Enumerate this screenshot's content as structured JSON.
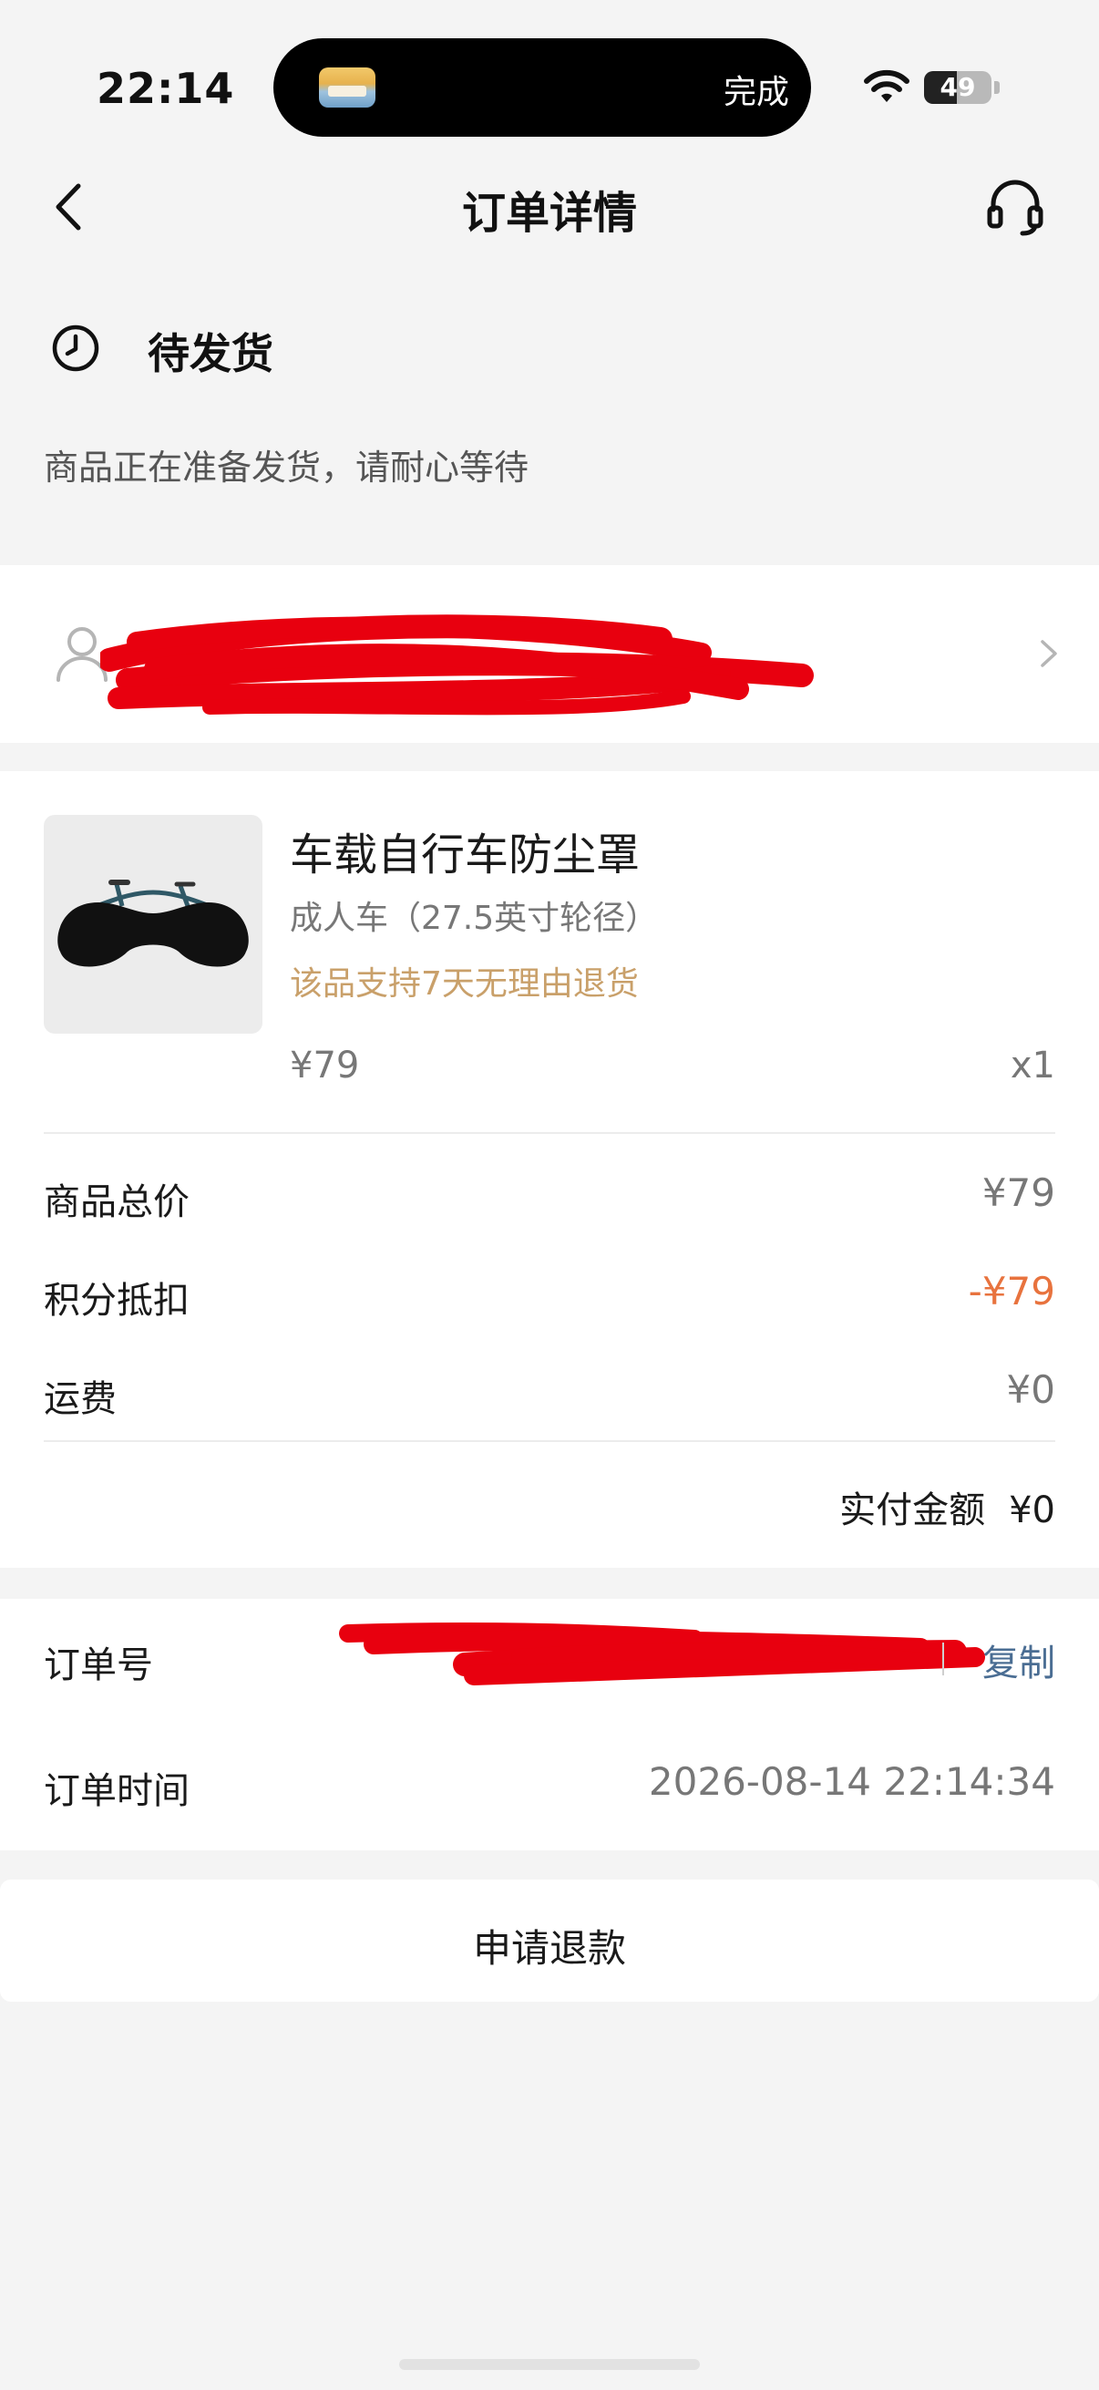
{
  "status_bar": {
    "time": "22:14",
    "island_text": "完成",
    "battery": "49",
    "battery_level": 0.49
  },
  "nav": {
    "title": "订单详情",
    "back_icon": "chevron-left-icon",
    "service_icon": "headset-icon"
  },
  "order_status": {
    "title": "待发货",
    "description": "商品正在准备发货，请耐心等待"
  },
  "address": {
    "name": "",
    "detail": ""
  },
  "product": {
    "name": "车载自行车防尘罩",
    "spec": "成人车（27.5英寸轮径）",
    "return_policy": "该品支持7天无理由退货",
    "price": "¥79",
    "quantity": "x1"
  },
  "summary": {
    "rows": [
      {
        "label": "商品总价",
        "value": "¥79"
      },
      {
        "label": "积分抵扣",
        "value": "-¥79"
      },
      {
        "label": "运费",
        "value": "¥0"
      }
    ],
    "paid_label": "实付金额",
    "paid_value": "¥0"
  },
  "order_info": {
    "number_label": "订单号",
    "copy_label": "复制",
    "time_label": "订单时间",
    "time_value": "2026-08-14 22:14:34"
  },
  "actions": {
    "refund_label": "申请退款"
  },
  "colors": {
    "accent_orange": "#e8733e",
    "return_gold": "#c9a06a",
    "link_blue": "#4a6d93",
    "redaction_red": "#e8000f"
  }
}
